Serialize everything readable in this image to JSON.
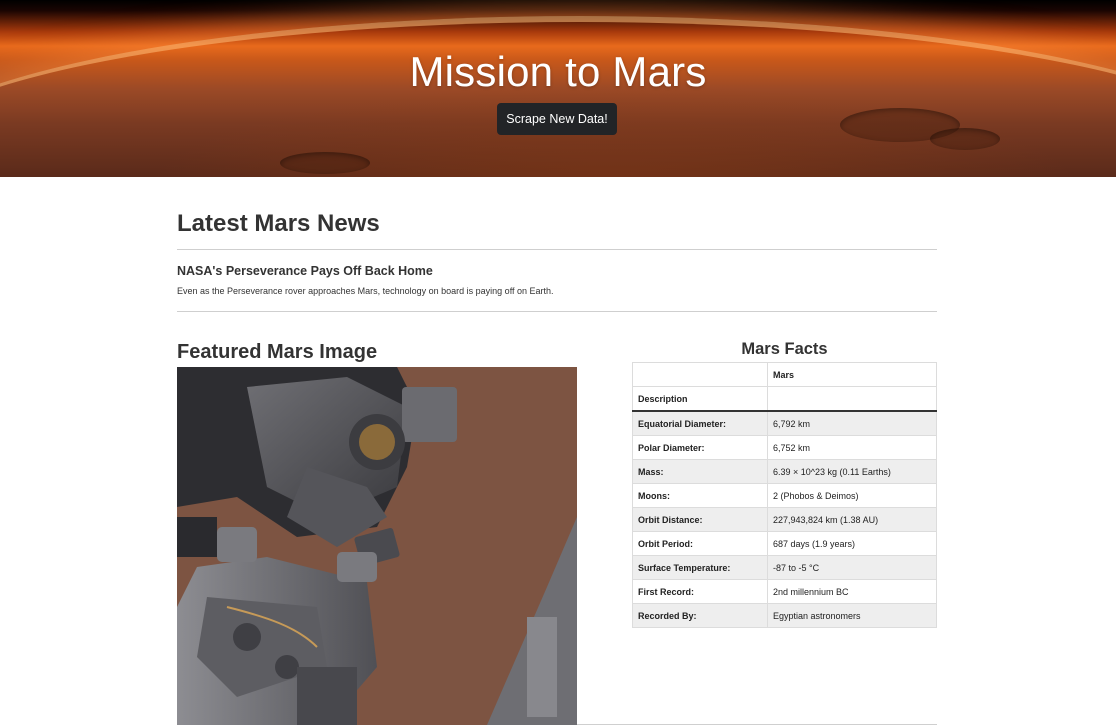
{
  "header": {
    "title": "Mission to Mars",
    "scrape_button": "Scrape New Data!"
  },
  "news": {
    "heading": "Latest Mars News",
    "title": "NASA's Perseverance Pays Off Back Home",
    "paragraph": "Even as the Perseverance rover approaches Mars, technology on board is paying off on Earth."
  },
  "featured": {
    "heading": "Featured Mars Image"
  },
  "facts": {
    "title": "Mars Facts",
    "column_header": "Mars",
    "description_label": "Description",
    "rows": [
      {
        "label": "Equatorial Diameter:",
        "value": "6,792 km"
      },
      {
        "label": "Polar Diameter:",
        "value": "6,752 km"
      },
      {
        "label": "Mass:",
        "value": "6.39 × 10^23 kg (0.11 Earths)"
      },
      {
        "label": "Moons:",
        "value": "2 (Phobos & Deimos)"
      },
      {
        "label": "Orbit Distance:",
        "value": "227,943,824 km (1.38 AU)"
      },
      {
        "label": "Orbit Period:",
        "value": "687 days (1.9 years)"
      },
      {
        "label": "Surface Temperature:",
        "value": "-87 to -5 °C"
      },
      {
        "label": "First Record:",
        "value": "2nd millennium BC"
      },
      {
        "label": "Recorded By:",
        "value": "Egyptian astronomers"
      }
    ]
  }
}
